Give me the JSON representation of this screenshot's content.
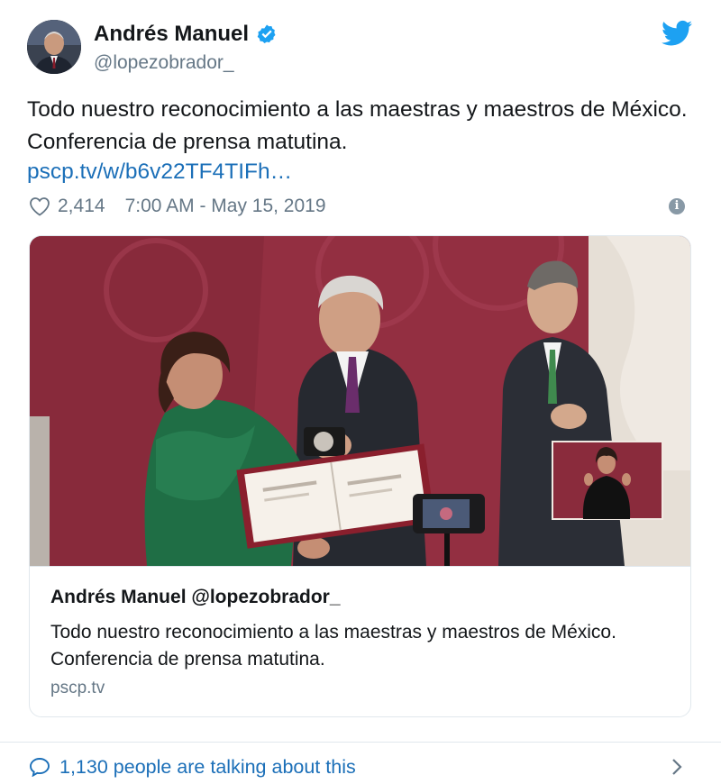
{
  "author": {
    "name": "Andrés Manuel",
    "handle": "@lopezobrador_",
    "verified": true
  },
  "tweet": {
    "text": "Todo nuestro reconocimiento a las maestras y maestros de México. Conferencia de prensa matutina.",
    "link": "pscp.tv/w/b6v22TF4TIFh…",
    "likes": "2,414",
    "timestamp": "7:00 AM - May 15, 2019"
  },
  "card": {
    "title": "Andrés Manuel @lopezobrador_",
    "description": "Todo nuestro reconocimiento a las maestras y maestros de México. Conferencia de prensa matutina.",
    "domain": "pscp.tv"
  },
  "footer": {
    "conversation": "1,130 people are talking about this"
  },
  "icons": {
    "verified": "verified-badge-icon",
    "brand": "twitter-bird-icon",
    "like": "heart-icon",
    "info": "info-icon",
    "reply": "speech-bubble-icon",
    "more": "chevron-right-icon"
  },
  "colors": {
    "link": "#1b6fb8",
    "verified": "#1da1f2",
    "brand": "#1da1f2",
    "muted": "#657786",
    "border": "#e1e8ed"
  }
}
